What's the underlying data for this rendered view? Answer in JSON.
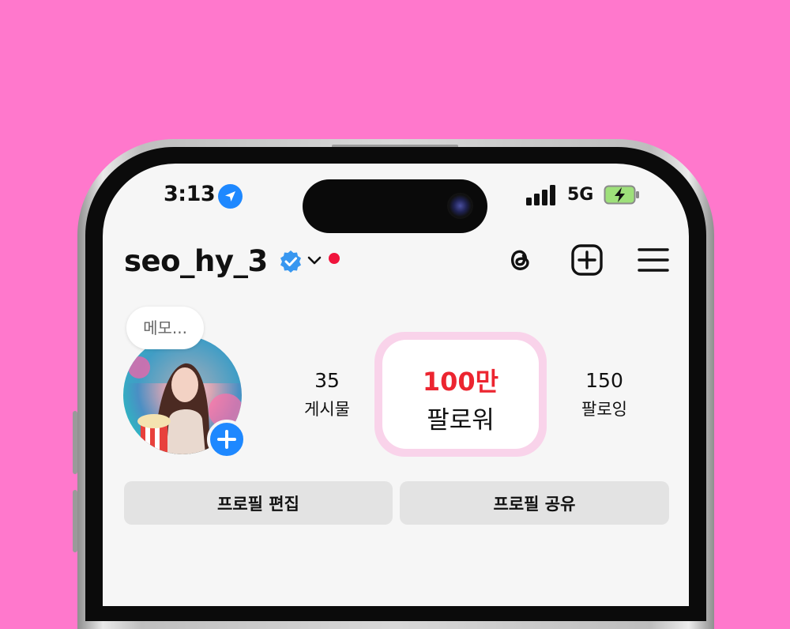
{
  "status_bar": {
    "time": "3:13",
    "network": "5G",
    "location_icon": "location-arrow-icon",
    "signal_icon": "cellular-signal-icon",
    "battery_icon": "battery-charging-icon"
  },
  "header": {
    "username": "seo_hy_3",
    "verified_icon": "verified-badge-icon",
    "dropdown_icon": "chevron-down-icon",
    "notification_dot_color": "#f0143c",
    "actions": [
      {
        "name": "threads-icon"
      },
      {
        "name": "add-post-icon"
      },
      {
        "name": "menu-icon"
      }
    ]
  },
  "profile": {
    "memo_placeholder": "메모...",
    "add_story_icon": "plus-icon",
    "stats": {
      "posts": {
        "value": "35",
        "label": "게시물"
      },
      "followers": {
        "value": "100만",
        "label": "팔로워"
      },
      "following": {
        "value": "150",
        "label": "팔로잉"
      }
    }
  },
  "buttons": {
    "edit_profile": "프로필 편집",
    "share_profile": "프로필 공유"
  },
  "colors": {
    "background": "#ff78cc",
    "accent_blue": "#1e88ff",
    "follower_highlight": "#f9d3ea",
    "follower_number": "#ec2530"
  }
}
